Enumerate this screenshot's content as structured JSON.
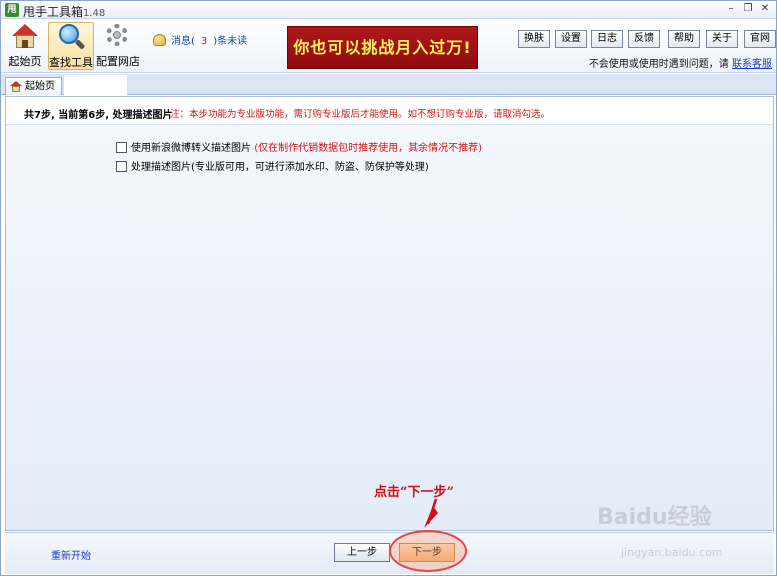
{
  "window": {
    "title": "甩手工具箱",
    "version": "1.48",
    "icon_text": "甩"
  },
  "toolbar": {
    "tools": [
      {
        "label": "起始页",
        "icon": "home-icon"
      },
      {
        "label": "查找工具",
        "icon": "search-icon"
      },
      {
        "label": "配置网店",
        "icon": "gear-icon"
      }
    ],
    "messages": {
      "prefix": "消息(",
      "count": "3",
      "suffix": ")条未读"
    },
    "banner": "你也可以挑战月入过万!",
    "buttons": [
      "换肤",
      "设置",
      "日志",
      "反馈",
      "帮助",
      "关于",
      "官网"
    ],
    "help_text": "不会使用或使用时遇到问题，请",
    "help_link": "联系客服"
  },
  "tabs": [
    {
      "label": "起始页",
      "icon": "home-icon"
    }
  ],
  "step": {
    "title": "共7步, 当前第6步, 处理描述图片",
    "note": "注：本步功能为专业版功能，需订购专业版后才能使用。如不想订购专业版，请取消勾选。",
    "options": [
      {
        "label": "使用新浪微博转义描述图片",
        "note": "(仅在制作代销数据包时推荐使用，其余情况不推荐)",
        "checked": false
      },
      {
        "label": "处理描述图片(专业版可用，可进行添加水印、防盗、防保护等处理)",
        "note": "",
        "checked": false
      }
    ]
  },
  "bottom": {
    "restart": "重新开始",
    "prev": "上一步",
    "next": "下一步"
  },
  "annotation": {
    "text": "点击“下一步”",
    "color": "#d30f16"
  },
  "watermark": {
    "text": "Baidu经验",
    "sub": "jingyan.baidu.com"
  },
  "colors": {
    "banner_bg": "#a3131a",
    "banner_text": "#fff35a",
    "note_red": "#d21515",
    "link_blue": "#1a3fc4"
  }
}
